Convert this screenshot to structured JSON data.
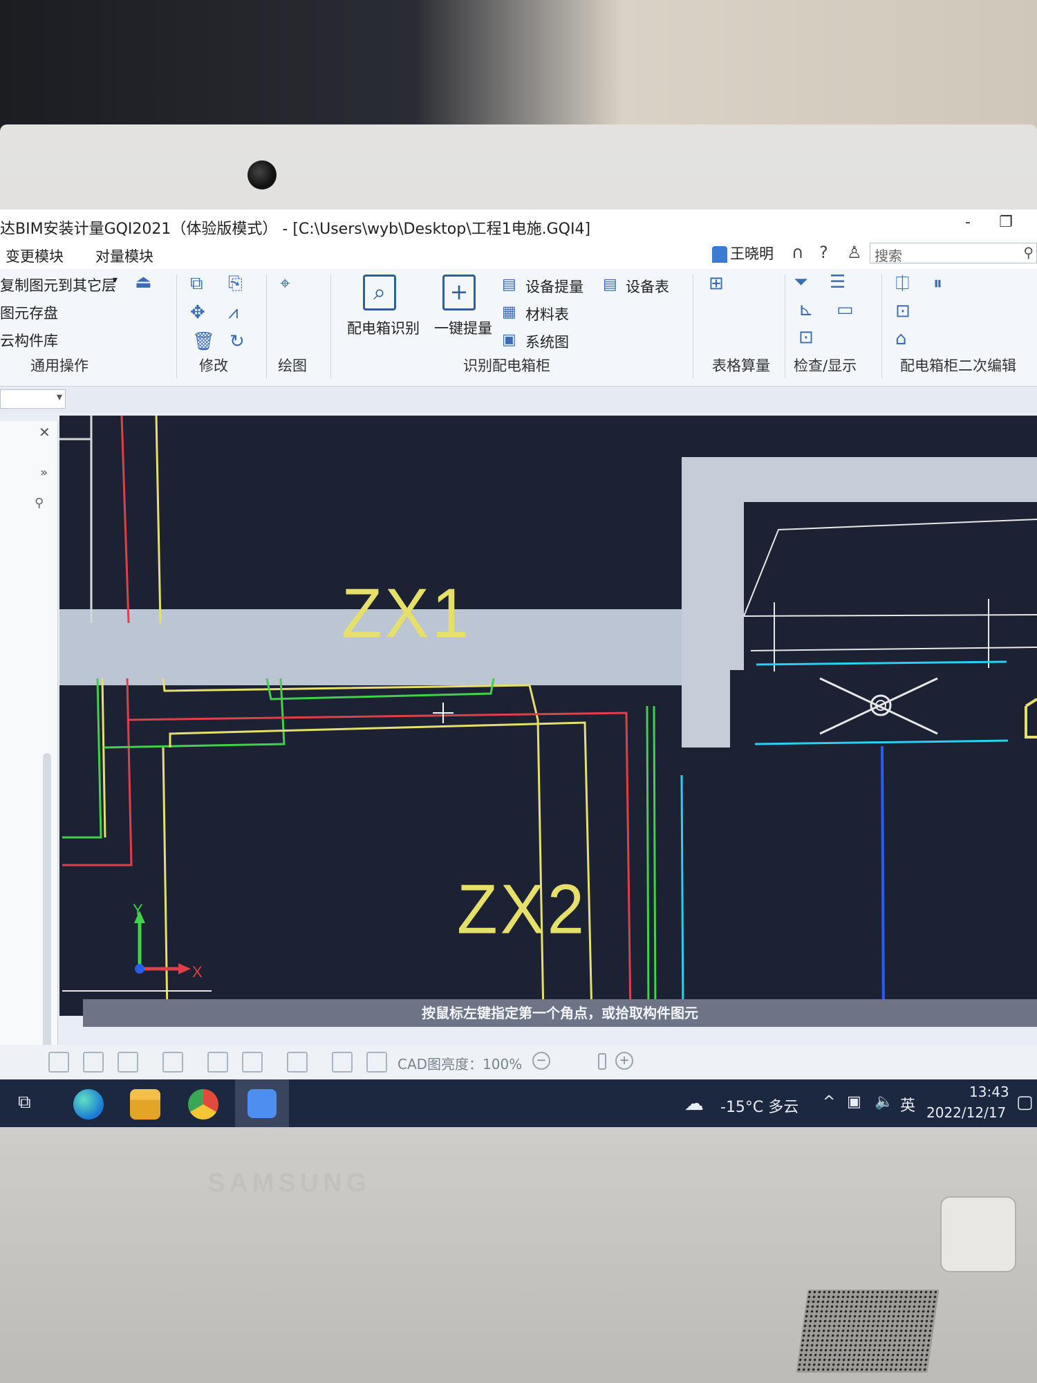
{
  "window": {
    "title": "达BIM安装计量GQI2021（体验版模式） - [C:\\Users\\wyb\\Desktop\\工程1电施.GQI4]",
    "minimize": "-",
    "restore": "❐"
  },
  "menubar": {
    "items": [
      "变更模块",
      "对量模块"
    ],
    "user": "王晓明",
    "headset_icon": "headset-icon",
    "help": "?",
    "search_placeholder": "搜索"
  },
  "ribbon": {
    "general": {
      "items": [
        "复制图元到其它层",
        "图元存盘",
        "云构件库"
      ],
      "group_label": "通用操作"
    },
    "modify": {
      "group_label": "修改"
    },
    "draw": {
      "group_label": "绘图"
    },
    "recognize": {
      "big_buttons": [
        "配电箱识别",
        "一键提量"
      ],
      "small_buttons": [
        "设备提量",
        "材料表",
        "系统图",
        "设备表"
      ],
      "group_label": "识别配电箱柜"
    },
    "table": {
      "group_label": "表格算量"
    },
    "check": {
      "group_label": "检查/显示"
    },
    "edit": {
      "group_label": "配电箱柜二次编辑"
    }
  },
  "cad": {
    "labels": [
      "ZX1",
      "ZX2"
    ],
    "axis_y": "Y",
    "axis_x": "X",
    "colors": {
      "background": "#1c2133",
      "yellow": "#e6e06a",
      "red": "#e0404a",
      "green": "#3fd24a",
      "cyan": "#2ad0f0",
      "blue": "#2a5cf0",
      "white": "#e8e8e8"
    }
  },
  "command_prompt": "按鼠标左键指定第一个角点，或拾取构件图元",
  "statusbar": {
    "brightness_label": "CAD图亮度：",
    "brightness_value": "100%"
  },
  "taskbar": {
    "weather": "-15°C 多云",
    "ime": "英",
    "time": "13:43",
    "date": "2022/12/17"
  },
  "device": {
    "brand": "SAMSUNG"
  }
}
